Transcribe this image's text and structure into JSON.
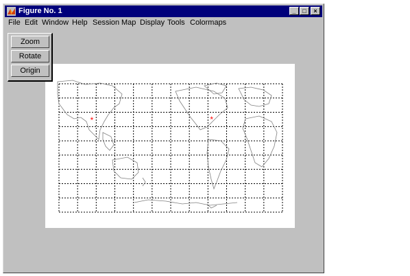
{
  "window": {
    "title": "Figure No. 1",
    "controls": {
      "minimize": "_",
      "maximize": "□",
      "close": "×"
    }
  },
  "menubar": {
    "items": [
      "File",
      "Edit",
      "Window",
      "Help",
      "Session",
      "Map",
      "Display",
      "Tools",
      "Colormaps"
    ]
  },
  "toolbox": {
    "buttons": [
      "Zoom",
      "Rotate",
      "Origin"
    ]
  },
  "map": {
    "grid_style": "dashed",
    "markers": [
      {
        "lon": 116,
        "lat": 40,
        "symbol": "*",
        "color": "#ff0000"
      },
      {
        "lon": -77,
        "lat": 39,
        "symbol": "*",
        "color": "#ff0000"
      }
    ],
    "outline_color": "#808080",
    "grid_color": "#000000"
  }
}
